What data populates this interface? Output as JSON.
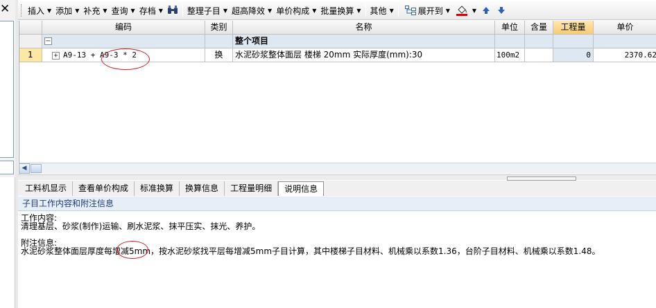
{
  "close_label": "✕",
  "toolbar": {
    "insert": "插入",
    "add": "添加",
    "supplement": "补充",
    "query": "查询",
    "archive": "存档",
    "organize": "整理子目",
    "height_reduce": "超高降效",
    "unit_price_composition": "单价构成",
    "batch_convert": "批量换算",
    "other": "其他",
    "expand_to": "展开到"
  },
  "grid": {
    "columns": {
      "code": "编码",
      "type": "类别",
      "name": "名称",
      "unit": "单位",
      "content": "含量",
      "quantity": "工程量",
      "unit_price": "单价"
    },
    "section": {
      "expander": "−",
      "name": "整个项目"
    },
    "rows": [
      {
        "index": "1",
        "expander": "+",
        "code": "A9-13 + A9-3 * 2",
        "type": "换",
        "name": "水泥砂浆整体面层 楼梯 20mm 实际厚度(mm):30",
        "unit": "100m2",
        "content": "",
        "quantity": "0",
        "unit_price": "2370.62"
      }
    ]
  },
  "tabs": [
    "工料机显示",
    "查看单价构成",
    "标准换算",
    "换算信息",
    "工程量明细",
    "说明信息"
  ],
  "info": {
    "header": "子目工作内容和附注信息",
    "work_label": "工作内容:",
    "work_text": "清理基层、砂浆(制作)运输、刷水泥浆、抹平压实、抹光、养护。",
    "note_label": "附注信息:",
    "note_text": "水泥砂浆整体面层厚度每增减5mm，按水泥砂浆找平层每增减5mm子目计算，其中楼梯子目材料、机械乘以系数1.36，台阶子目材料、机械乘以系数1.48。"
  },
  "colors": {
    "accent_blue": "#1e3a78",
    "header_highlight": "#f8cc70",
    "row_number_bg": "#fce8a2",
    "annotation_red": "#d02020"
  }
}
